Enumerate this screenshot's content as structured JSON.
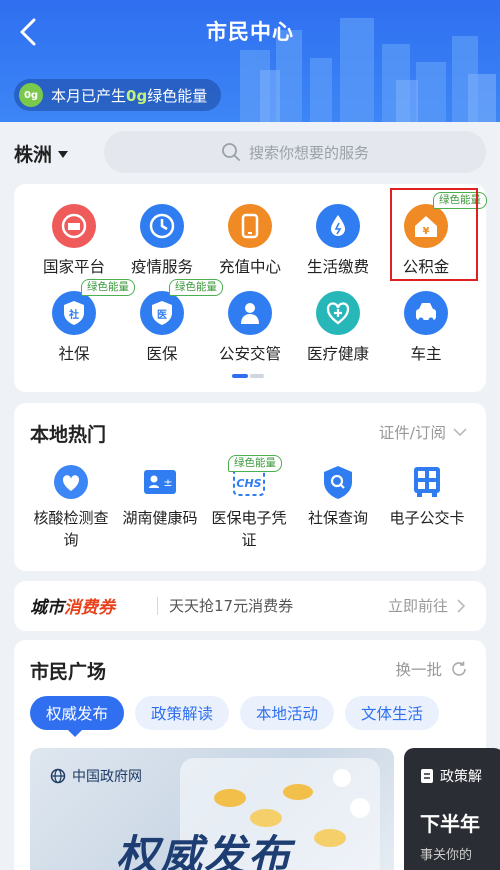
{
  "header": {
    "title": "市民中心",
    "energy": {
      "prefix": "本月已产生",
      "value": "0g",
      "suffix": "绿色能量",
      "badge": "0g"
    }
  },
  "city": {
    "name": "株洲"
  },
  "search": {
    "placeholder": "搜索你想要的服务"
  },
  "green_tag": "绿色能量",
  "services": [
    {
      "label": "国家平台",
      "icon": "national-platform-icon",
      "color": "#ef5a5a",
      "tag": false
    },
    {
      "label": "疫情服务",
      "icon": "epidemic-clock-icon",
      "color": "#2f7df0",
      "tag": false
    },
    {
      "label": "充值中心",
      "icon": "phone-recharge-icon",
      "color": "#f08a24",
      "tag": false
    },
    {
      "label": "生活缴费",
      "icon": "water-drop-icon",
      "color": "#2f7df0",
      "tag": false
    },
    {
      "label": "公积金",
      "icon": "housing-fund-icon",
      "color": "#f08a24",
      "tag": true
    },
    {
      "label": "社保",
      "icon": "social-security-shield-icon",
      "color": "#2f7df0",
      "tag": true
    },
    {
      "label": "医保",
      "icon": "medical-insurance-shield-icon",
      "color": "#2f7df0",
      "tag": true
    },
    {
      "label": "公安交管",
      "icon": "police-icon",
      "color": "#2f7df0",
      "tag": false
    },
    {
      "label": "医疗健康",
      "icon": "health-heart-icon",
      "color": "#28b7b8",
      "tag": false
    },
    {
      "label": "车主",
      "icon": "car-icon",
      "color": "#2f7df0",
      "tag": false
    }
  ],
  "hot": {
    "title": "本地热门",
    "more": "证件/订阅",
    "items": [
      {
        "label": "核酸检测查询",
        "icon": "nucleic-test-heart-icon",
        "tag": false
      },
      {
        "label": "湖南健康码",
        "icon": "health-code-card-icon",
        "tag": false
      },
      {
        "label": "医保电子凭证",
        "icon": "chs-icon",
        "tag": true
      },
      {
        "label": "社保查询",
        "icon": "social-security-search-icon",
        "tag": false
      },
      {
        "label": "电子公交卡",
        "icon": "bus-qr-icon",
        "tag": false
      }
    ]
  },
  "coupon": {
    "logo_a": "城市",
    "logo_b": "消费券",
    "text": "天天抢17元消费券",
    "go": "立即前往"
  },
  "plaza": {
    "title": "市民广场",
    "more": "换一批",
    "tabs": [
      "权威发布",
      "政策解读",
      "本地活动",
      "文体生活"
    ],
    "banner": {
      "source": "中国政府网",
      "big": "权威发布"
    },
    "banner2": {
      "source": "政策解",
      "title": "下半年",
      "sub": "事关你的"
    }
  },
  "colors": {
    "primary": "#2f6ff0",
    "green": "#4caf50",
    "highlight": "#e02020"
  }
}
